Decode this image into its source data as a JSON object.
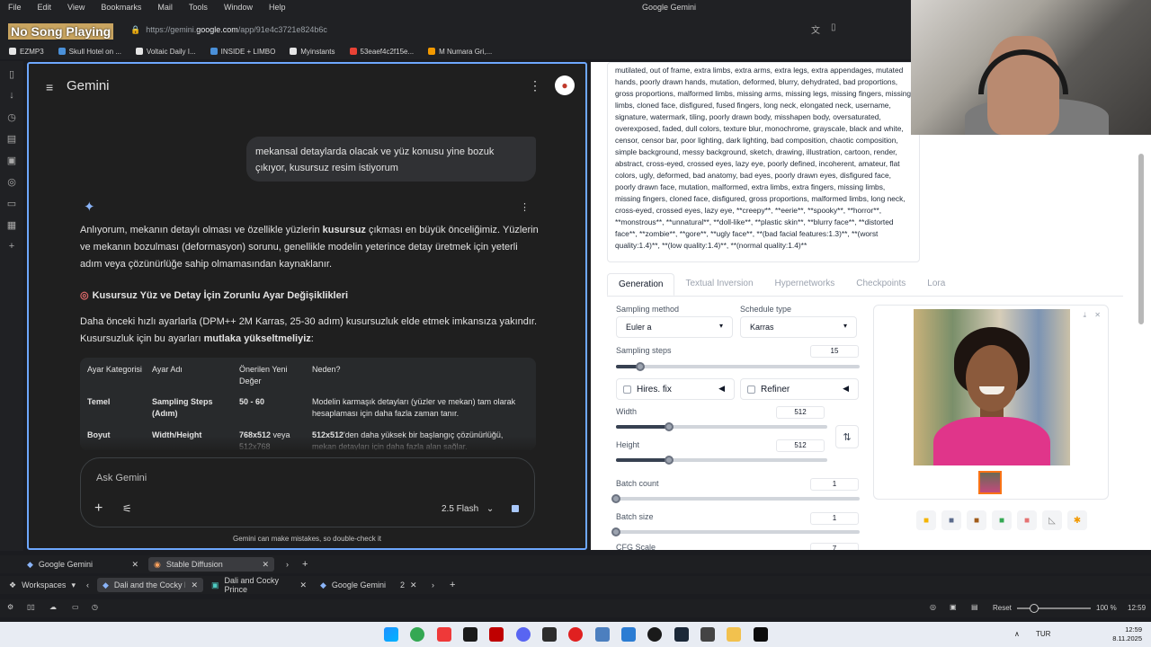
{
  "menubar": {
    "items": [
      "File",
      "Edit",
      "View",
      "Bookmarks",
      "Mail",
      "Tools",
      "Window",
      "Help"
    ],
    "window_title": "Google Gemini"
  },
  "overlay": {
    "song": "No Song Playing"
  },
  "address": {
    "prefix": "https://gemini.",
    "domain": "google.com",
    "suffix": "/app/91e4c3721e824b6c"
  },
  "bookmarks": [
    "EZMP3",
    "Skull Hotel on ...",
    "Voltaic Daily I...",
    "INSIDE + LIMBO",
    "Myinstants",
    "53eaef4c2f15e...",
    "M Numara Gri,..."
  ],
  "gemini": {
    "title": "Gemini",
    "user_message": "mekansal detaylarda olacak ve yüz konusu yine bozuk çıkıyor, kusursuz resim istiyorum",
    "response_p1_a": "Anlıyorum, mekanın detaylı olması ve özellikle yüzlerin ",
    "response_p1_bold": "kusursuz",
    "response_p1_b": " çıkması en büyük önceliğimiz. Yüzlerin ve mekanın bozulması (deformasyon) sorunu, genellikle modelin yeterince detay üretmek için yeterli adım veya çözünürlüğe sahip olmamasından kaynaklanır.",
    "heading": "Kusursuz Yüz ve Detay İçin Zorunlu Ayar Değişiklikleri",
    "response_p2_a": "Daha önceki hızlı ayarlarla (DPM++ 2M Karras, 25-30 adım) kusursuzluk elde etmek imkansıza yakındır. Kusursuzluk için bu ayarları ",
    "response_p2_bold": "mutlaka yükseltmeliyiz",
    "response_p2_b": ":",
    "table": {
      "headers": [
        "Ayar Kategorisi",
        "Ayar Adı",
        "Önerilen Yeni Değer",
        "Neden?"
      ],
      "rows": [
        [
          "Temel",
          "Sampling Steps (Adım)",
          "50 - 60",
          "Modelin karmaşık detayları (yüzler ve mekan) tam olarak hesaplaması için daha fazla zaman tanır."
        ],
        [
          "Boyut",
          "Width/Height",
          "768x512 veya 512x768",
          "512x512'den daha yüksek bir başlangıç çözünürlüğü, mekan detayları için daha fazla alan sağlar."
        ]
      ],
      "row2_value_a": "768x512",
      "row2_value_b": " veya 512x768",
      "row2_reason_a": "512x512",
      "row2_reason_b": "'den daha yüksek bir başlangıç çözünürlüğü, mekan detayları için daha fazla alan sağlar."
    },
    "ask_placeholder": "Ask Gemini",
    "model": "2.5 Flash",
    "disclaimer": "Gemini can make mistakes, so double-check it"
  },
  "sd": {
    "negative_prompt": "mutilated, out of frame, extra limbs, extra arms, extra legs, extra appendages, mutated hands, poorly drawn hands, mutation, deformed, blurry, dehydrated, bad proportions, gross proportions, malformed limbs, missing arms, missing legs, missing fingers, missing limbs, cloned face, disfigured, fused fingers, long neck, elongated neck, username, signature, watermark, tiling, poorly drawn body, misshapen body, oversaturated, overexposed, faded, dull colors, texture blur, monochrome, grayscale, black and white, censor, censor bar, poor lighting, dark lighting, bad composition, chaotic composition, simple background, messy background, sketch, drawing, illustration, cartoon, render, abstract, cross-eyed, crossed eyes, lazy eye, poorly defined, incoherent, amateur, flat colors, ugly, deformed, bad anatomy, bad eyes, poorly drawn eyes, disfigured face, poorly drawn face, mutation, malformed, extra limbs, extra fingers, missing limbs, missing fingers, cloned face, disfigured, gross proportions, malformed limbs, long neck, cross-eyed, crossed eyes, lazy eye, **creepy**, **eerie**, **spooky**, **horror**, **monstrous**, **unnatural**, **doll-like**, **plastic skin**, **blurry face**, **distorted face**, **zombie**, **gore**, **ugly face**, **(bad facial features:1.3)**, **(worst quality:1.4)**, **(low quality:1.4)**, **(normal quality:1.4)**",
    "tabs": [
      "Generation",
      "Textual Inversion",
      "Hypernetworks",
      "Checkpoints",
      "Lora"
    ],
    "sampling_method_label": "Sampling method",
    "sampling_method": "Euler a",
    "schedule_type_label": "Schedule type",
    "schedule_type": "Karras",
    "sampling_steps_label": "Sampling steps",
    "sampling_steps": 15,
    "sampling_steps_max": 150,
    "hires_label": "Hires. fix",
    "refiner_label": "Refiner",
    "width_label": "Width",
    "width": 512,
    "height_label": "Height",
    "height": 512,
    "size_max": 2048,
    "batch_count_label": "Batch count",
    "batch_count": 1,
    "batch_size_label": "Batch size",
    "batch_size": 1,
    "cfg_label": "CFG Scale",
    "cfg": 7
  },
  "tabs_row1": [
    {
      "label": "Google Gemini"
    },
    {
      "label": "Stable Diffusion"
    }
  ],
  "tabs_row2": {
    "workspaces": "Workspaces",
    "items": [
      "Dali and the Cocky Prin",
      "Dali and Cocky Prince",
      "Google Gemini"
    ],
    "group_count": "2"
  },
  "status": {
    "reset": "Reset",
    "zoom": "100 %",
    "time_small": "12:59"
  },
  "taskbar": {
    "lang": "TUR",
    "time": "12:59",
    "date": "8.11.2025"
  }
}
